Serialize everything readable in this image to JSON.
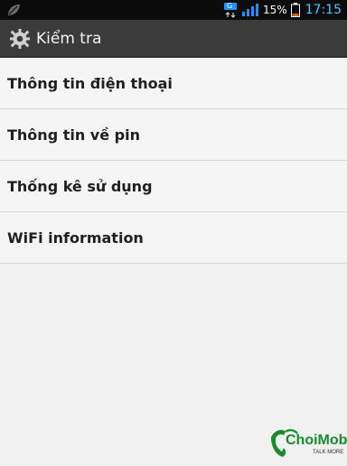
{
  "status_bar": {
    "left_icon": "leaf-icon",
    "network_badge": "G",
    "battery_percent": "15%",
    "time": "17:15",
    "colors": {
      "time": "#4ec4ff",
      "badge": "#1e90ff",
      "battery": "#d46a00"
    }
  },
  "action_bar": {
    "title": "Kiểm tra",
    "icon": "gear-icon"
  },
  "list": {
    "items": [
      {
        "label": "Thông tin điện thoại"
      },
      {
        "label": "Thông tin về pin"
      },
      {
        "label": "Thống kê sử dụng"
      },
      {
        "label": "WiFi information"
      }
    ]
  },
  "watermark": {
    "brand": "ChoiMobile",
    "tagline": "TALK MORE",
    "icon": "phone-icon"
  }
}
